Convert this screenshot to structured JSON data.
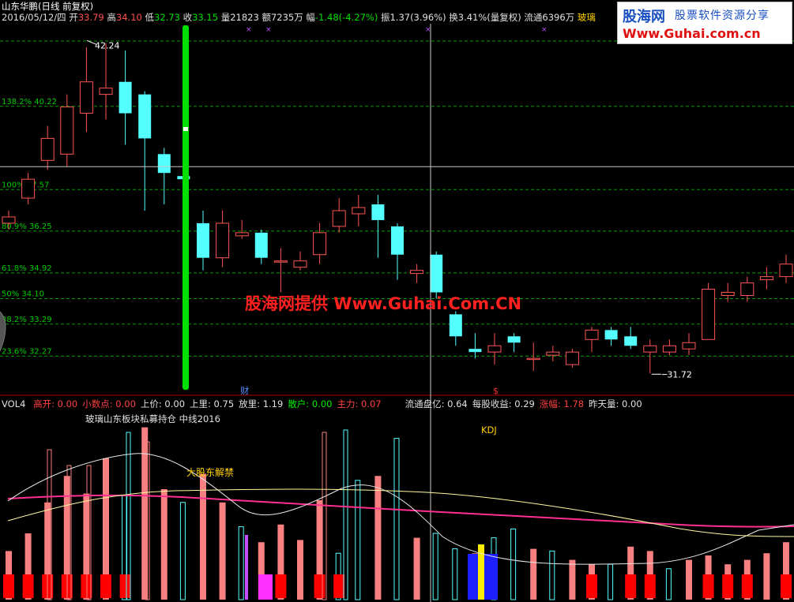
{
  "header": {
    "title": "山东华鹏(日线 前复权)",
    "date": "2016/05/12/四",
    "open_label": "开",
    "open": "33.79",
    "high_label": "高",
    "high": "34.10",
    "low_label": "低",
    "low": "32.73",
    "close_label": "收",
    "close": "33.15",
    "vol_label": "量",
    "vol": "21823",
    "amount_label": "额",
    "amount": "7235万",
    "change_label": "幅",
    "change": "-1.48(-4.27%)",
    "amp_label": "振",
    "amp": "1.37(3.96%)",
    "turnover_label": "换",
    "turnover": "3.41%(量复权)",
    "float_label": "流通",
    "float_shares": "6396万",
    "sector": "玻璃"
  },
  "logo": {
    "brand": "股海网",
    "slogan": "股票软件资源分享",
    "url": "Www.Guhai.com.cn"
  },
  "watermark": "股海网提供 Www.Guhai.Com.CN",
  "colors": {
    "up": "#ff5555",
    "down": "#54ffff",
    "fib_line": "#00a000",
    "fib_label": "#00cc00",
    "highlight_bar": "#00e000",
    "watermark": "#ff2020",
    "crosshair": "#c8c8c8"
  },
  "chart_data": {
    "type": "candlestick",
    "price_range": [
      31.3,
      42.6
    ],
    "high_marker": "42.24",
    "low_marker": "31.72",
    "fib_levels": [
      {
        "label": "138.2% 40.22",
        "value": 40.22
      },
      {
        "label": "100% 37.57",
        "value": 37.57
      },
      {
        "label": "80.9% 36.25",
        "value": 36.25
      },
      {
        "label": "61.8% 34.92",
        "value": 34.92
      },
      {
        "label": "50% 34.10",
        "value": 34.1
      },
      {
        "label": "38.2% 33.29",
        "value": 33.29
      },
      {
        "label": "23.6% 32.27",
        "value": 32.27
      }
    ],
    "crosshair_price": 38.3,
    "candles": [
      {
        "o": 36.5,
        "c": 36.7,
        "h": 36.9,
        "l": 36.3
      },
      {
        "o": 37.3,
        "c": 37.9,
        "h": 38.1,
        "l": 37.1
      },
      {
        "o": 38.5,
        "c": 39.2,
        "h": 39.6,
        "l": 38.2
      },
      {
        "o": 38.7,
        "c": 40.2,
        "h": 40.6,
        "l": 38.3
      },
      {
        "o": 40.0,
        "c": 41.0,
        "h": 42.1,
        "l": 39.4
      },
      {
        "o": 40.6,
        "c": 40.8,
        "h": 42.24,
        "l": 39.8
      },
      {
        "o": 41.0,
        "c": 40.0,
        "h": 42.0,
        "l": 39.0
      },
      {
        "o": 40.6,
        "c": 39.2,
        "h": 40.7,
        "l": 36.9
      },
      {
        "o": 38.7,
        "c": 38.1,
        "h": 38.9,
        "l": 37.1
      },
      {
        "o": 38.0,
        "c": 37.9,
        "h": 38.8,
        "l": 37.7
      },
      {
        "o": 36.5,
        "c": 35.4,
        "h": 36.9,
        "l": 35.0
      },
      {
        "o": 35.4,
        "c": 36.5,
        "h": 36.9,
        "l": 35.1
      },
      {
        "o": 36.1,
        "c": 36.2,
        "h": 36.6,
        "l": 36.0
      },
      {
        "o": 36.2,
        "c": 35.4,
        "h": 36.3,
        "l": 35.2
      },
      {
        "o": 35.3,
        "c": 35.3,
        "h": 35.7,
        "l": 34.3
      },
      {
        "o": 35.1,
        "c": 35.3,
        "h": 35.6,
        "l": 35.0
      },
      {
        "o": 35.5,
        "c": 36.2,
        "h": 36.5,
        "l": 35.2
      },
      {
        "o": 36.4,
        "c": 36.9,
        "h": 37.3,
        "l": 36.2
      },
      {
        "o": 36.8,
        "c": 37.0,
        "h": 37.4,
        "l": 36.4
      },
      {
        "o": 37.1,
        "c": 36.6,
        "h": 37.4,
        "l": 35.4
      },
      {
        "o": 36.4,
        "c": 35.5,
        "h": 36.5,
        "l": 34.7
      },
      {
        "o": 34.9,
        "c": 35.0,
        "h": 35.2,
        "l": 34.6
      },
      {
        "o": 35.5,
        "c": 34.3,
        "h": 35.6,
        "l": 34.1
      },
      {
        "o": 33.6,
        "c": 32.9,
        "h": 33.7,
        "l": 32.6
      },
      {
        "o": 32.5,
        "c": 32.4,
        "h": 33.0,
        "l": 32.2
      },
      {
        "o": 32.4,
        "c": 32.6,
        "h": 33.0,
        "l": 32.0
      },
      {
        "o": 32.9,
        "c": 32.7,
        "h": 33.0,
        "l": 32.4
      },
      {
        "o": 32.2,
        "c": 32.2,
        "h": 32.7,
        "l": 31.8
      },
      {
        "o": 32.3,
        "c": 32.4,
        "h": 32.6,
        "l": 32.1
      },
      {
        "o": 32.0,
        "c": 32.4,
        "h": 32.5,
        "l": 31.9
      },
      {
        "o": 32.8,
        "c": 33.1,
        "h": 33.2,
        "l": 32.4
      },
      {
        "o": 33.1,
        "c": 32.8,
        "h": 33.2,
        "l": 32.6
      },
      {
        "o": 32.9,
        "c": 32.6,
        "h": 33.2,
        "l": 32.5
      },
      {
        "o": 32.4,
        "c": 32.6,
        "h": 32.8,
        "l": 31.72
      },
      {
        "o": 32.4,
        "c": 32.6,
        "h": 32.8,
        "l": 32.3
      },
      {
        "o": 32.5,
        "c": 32.7,
        "h": 33.0,
        "l": 32.3
      },
      {
        "o": 32.8,
        "c": 34.4,
        "h": 34.6,
        "l": 32.8
      },
      {
        "o": 34.2,
        "c": 34.3,
        "h": 34.6,
        "l": 34.0
      },
      {
        "o": 34.2,
        "c": 34.6,
        "h": 34.8,
        "l": 34.0
      },
      {
        "o": 34.7,
        "c": 34.8,
        "h": 35.1,
        "l": 34.4
      },
      {
        "o": 34.8,
        "c": 35.2,
        "h": 35.5,
        "l": 34.6
      },
      {
        "o": 35.6,
        "c": 35.7,
        "h": 35.9,
        "l": 34.9
      },
      {
        "o": 35.6,
        "c": 35.3,
        "h": 35.7,
        "l": 35.3
      }
    ],
    "event_markers": [
      {
        "text": "财",
        "color": "#5a8cff",
        "index": 12
      },
      {
        "text": "$",
        "color": "#ff3030",
        "index": 25
      }
    ]
  },
  "indicator": {
    "name": "VOL4",
    "fields": [
      {
        "label": "高开:",
        "value": "0.00",
        "color": "#ff4040"
      },
      {
        "label": "小数点:",
        "value": "0.00",
        "color": "#ff4040"
      },
      {
        "label": "上价:",
        "value": "0.00",
        "color": "#e0e0e0"
      },
      {
        "label": "上里:",
        "value": "0.75",
        "color": "#e0e0e0"
      },
      {
        "label": "放里:",
        "value": "1.19",
        "color": "#e0e0e0"
      },
      {
        "label": "散户:",
        "value": "0.00",
        "color": "#00ee00"
      },
      {
        "label": "主力:",
        "value": "0.07",
        "color": "#ff4040"
      },
      {
        "label": "流通盘亿:",
        "value": "0.64",
        "color": "#e0e0e0"
      },
      {
        "label": "每股收益:",
        "value": "0.29",
        "color": "#e0e0e0"
      },
      {
        "label": "涨幅:",
        "value": "1.78",
        "color": "#ff4040"
      },
      {
        "label": "昨天量:",
        "value": "0.00",
        "color": "#e0e0e0"
      }
    ],
    "caption": "玻璃山东板块私募持仓 中线2016",
    "kdj_label": "KDJ",
    "annotation": "大股东解禁"
  },
  "vol_chart_data": {
    "type": "bar",
    "volume_bars": [
      22,
      30,
      44,
      56,
      48,
      64,
      47,
      78,
      50,
      44,
      57,
      44,
      33,
      26,
      34,
      27,
      45,
      21,
      54,
      56,
      73,
      28,
      30,
      23,
      21,
      28,
      32,
      23,
      22,
      18,
      16,
      16,
      24,
      22,
      14,
      18,
      20,
      16,
      18,
      21,
      26,
      23,
      25
    ],
    "bar_kinds": [
      "u",
      "u",
      "u",
      "u",
      "u",
      "u",
      "d",
      "u",
      "u",
      "d",
      "u",
      "u",
      "d",
      "u",
      "u",
      "u",
      "u",
      "d",
      "d",
      "u",
      "d",
      "u",
      "d",
      "d",
      "u",
      "d",
      "d",
      "u",
      "d",
      "u",
      "u",
      "d",
      "u",
      "u",
      "d",
      "u",
      "u",
      "u",
      "u",
      "u",
      "u",
      "u",
      "d"
    ],
    "red_blocks": [
      1,
      1,
      1,
      1,
      1,
      1,
      1,
      0,
      0,
      0,
      0,
      0,
      0,
      0,
      1,
      0,
      1,
      1,
      0,
      0,
      0,
      0,
      0,
      0,
      0,
      0,
      0,
      0,
      0,
      0,
      1,
      0,
      1,
      1,
      0,
      0,
      1,
      1,
      1,
      0,
      1,
      0,
      0
    ]
  }
}
